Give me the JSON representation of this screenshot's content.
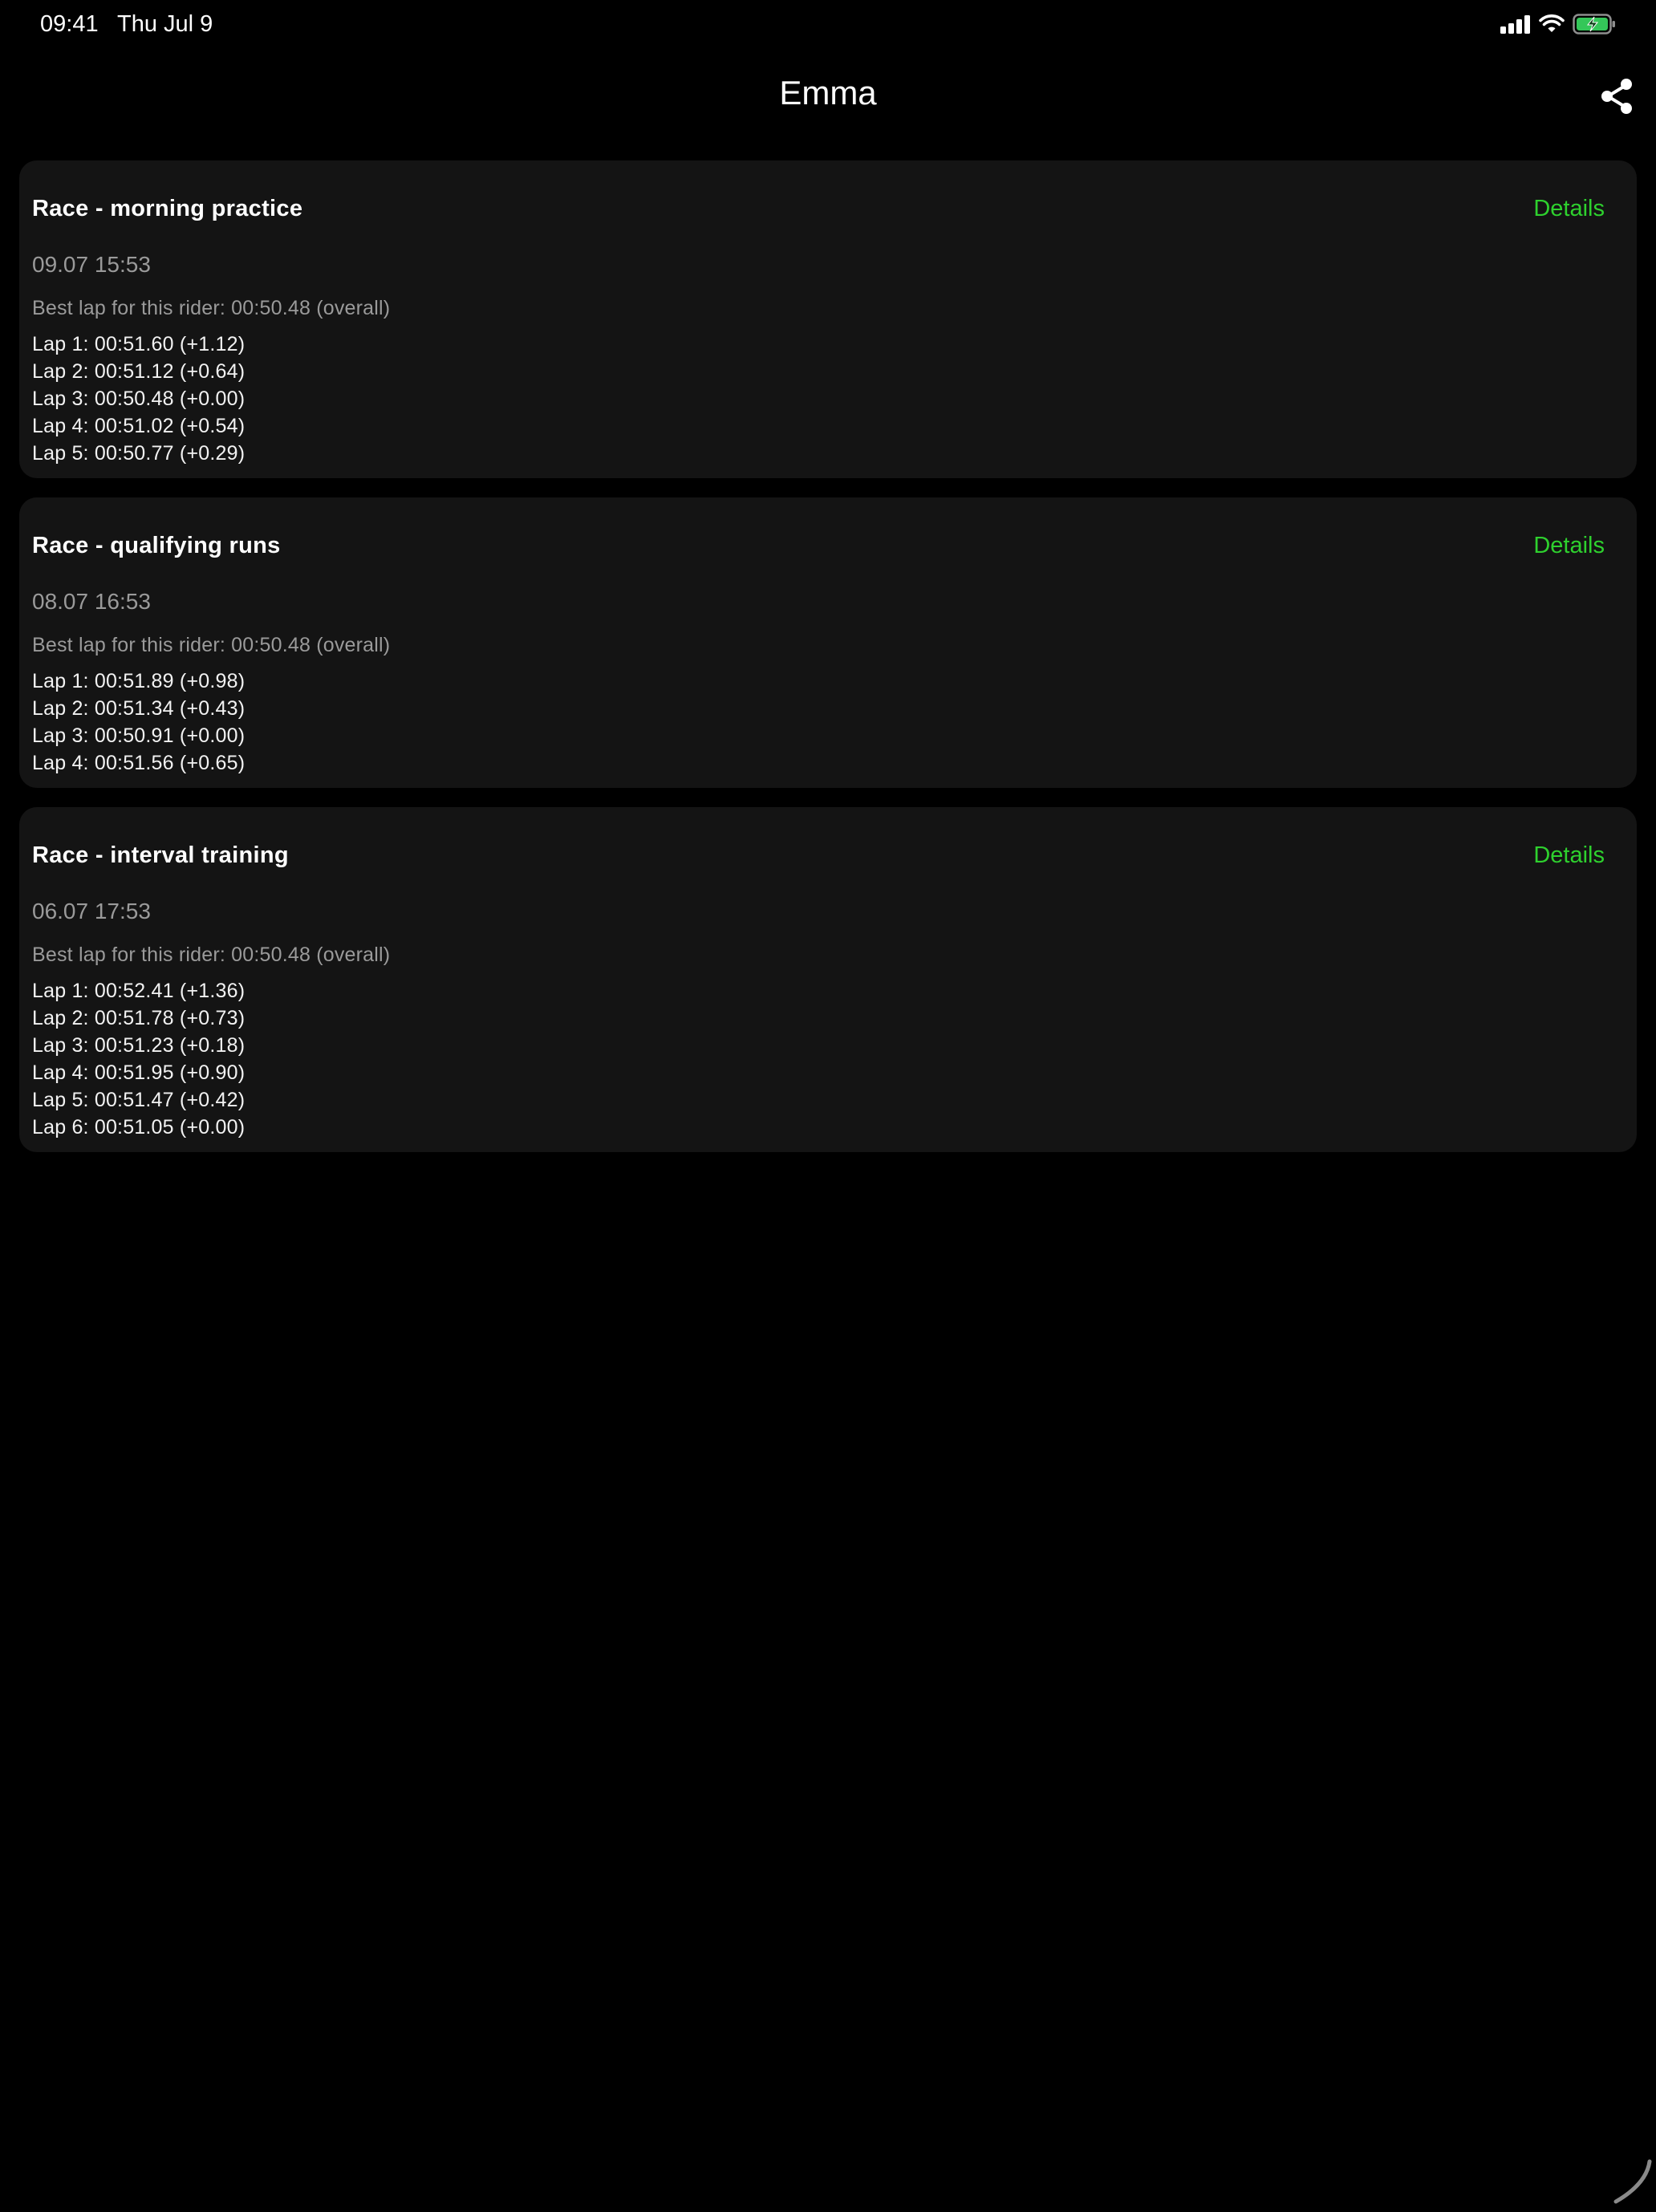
{
  "status_bar": {
    "time": "09:41",
    "date": "Thu Jul 9",
    "icons": [
      "cellular-signal-icon",
      "wifi-icon",
      "battery-charging-icon"
    ],
    "battery_color": "#34c759"
  },
  "nav": {
    "title": "Emma",
    "share_icon": "share-icon"
  },
  "accent_color": "#2ed12e",
  "races": [
    {
      "title": "Race - morning practice",
      "details_label": "Details",
      "date": "09.07 15:53",
      "best_lap": "Best lap for this rider: 00:50.48 (overall)",
      "laps": [
        "Lap 1: 00:51.60 (+1.12)",
        "Lap 2: 00:51.12 (+0.64)",
        "Lap 3: 00:50.48 (+0.00)",
        "Lap 4: 00:51.02 (+0.54)",
        "Lap 5: 00:50.77 (+0.29)"
      ]
    },
    {
      "title": "Race - qualifying runs",
      "details_label": "Details",
      "date": "08.07 16:53",
      "best_lap": "Best lap for this rider: 00:50.48 (overall)",
      "laps": [
        "Lap 1: 00:51.89 (+0.98)",
        "Lap 2: 00:51.34 (+0.43)",
        "Lap 3: 00:50.91 (+0.00)",
        "Lap 4: 00:51.56 (+0.65)"
      ]
    },
    {
      "title": "Race - interval training",
      "details_label": "Details",
      "date": "06.07 17:53",
      "best_lap": "Best lap for this rider: 00:50.48 (overall)",
      "laps": [
        "Lap 1: 00:52.41 (+1.36)",
        "Lap 2: 00:51.78 (+0.73)",
        "Lap 3: 00:51.23 (+0.18)",
        "Lap 4: 00:51.95 (+0.90)",
        "Lap 5: 00:51.47 (+0.42)",
        "Lap 6: 00:51.05 (+0.00)"
      ]
    }
  ]
}
